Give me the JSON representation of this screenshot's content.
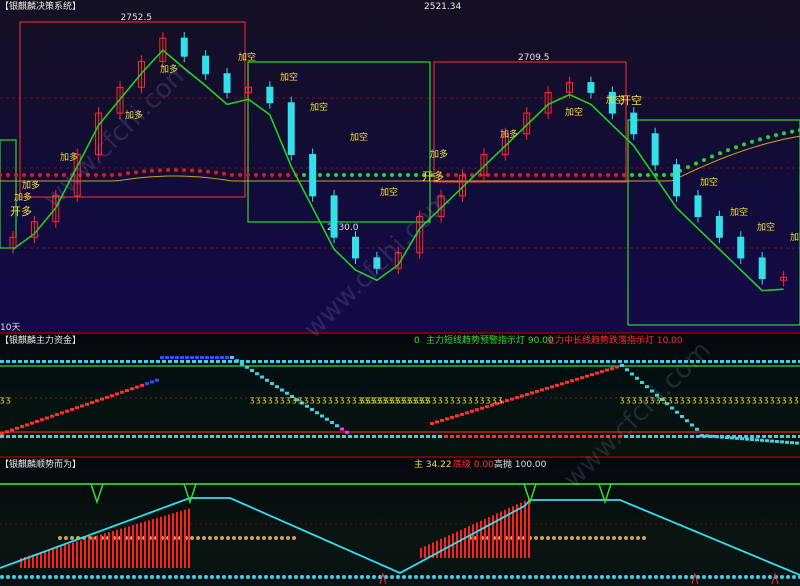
{
  "panel1": {
    "title": "【银麒麟决策系统】",
    "value": "2521.34",
    "period_label": "10天",
    "colors": {
      "up": "#ff2a2a",
      "down": "#33e0e8",
      "ma_red": "#ff2020",
      "ma_green": "#20d020",
      "yellow": "#d4a017",
      "text_signal": "#f0e040"
    }
  },
  "panel2": {
    "title": "【银麒麟主力资金】",
    "zero_label": "0",
    "legend": [
      {
        "text": "主力短线趋势预警指示灯 90.00",
        "color": "#33e033"
      },
      {
        "text": "主力中长线趋势跌落指示灯 10.00",
        "color": "#ff3030"
      }
    ]
  },
  "panel3": {
    "title": "【银麒麟顺势而为】",
    "legend": [
      {
        "text": "主 34.22",
        "color": "#f0e040"
      },
      {
        "text": "底级 0.00",
        "color": "#ff3030"
      },
      {
        "text": "高抛 100.00",
        "color": "#e0e0e0"
      }
    ]
  },
  "watermark": "www.cfchi.com",
  "chart_data": [
    {
      "type": "candlestick",
      "title": "【银麒麟决策系统】",
      "y_labels_printed": [
        "2752.5",
        "2530.0",
        "2709.5"
      ],
      "boxes": [
        {
          "color": "red",
          "label": "2752.5"
        },
        {
          "color": "green",
          "label": "2530.0"
        },
        {
          "color": "red",
          "label": "2709.5"
        },
        {
          "color": "green",
          "label": ""
        }
      ],
      "annotations": [
        "开多",
        "加多",
        "加多",
        "加多",
        "加多",
        "加多",
        "加空",
        "加空",
        "加空",
        "加空",
        "加空",
        "开多",
        "加多",
        "加多",
        "加空",
        "开空",
        "加空",
        "加空",
        "加空",
        "加空",
        "加空"
      ],
      "series": [
        {
          "name": "",
          "values": [
            2560,
            2575,
            2600,
            2640,
            2680,
            2705,
            2730,
            2752.5,
            2735,
            2718,
            2700,
            2705,
            2690,
            2640,
            2600,
            2560,
            2540,
            2530,
            2545,
            2580,
            2600,
            2620,
            2640,
            2660,
            2680,
            2700,
            2709.5,
            2700,
            2680,
            2660,
            2630,
            2600,
            2580,
            2560,
            2540,
            2520,
            2521.34
          ]
        }
      ]
    },
    {
      "type": "line",
      "title": "【银麒麟主力资金】",
      "series": [
        {
          "name": "主力短线趋势预警指示灯",
          "values": [
            90
          ]
        },
        {
          "name": "主力中长线趋势跌落指示灯",
          "values": [
            10
          ]
        }
      ]
    },
    {
      "type": "line",
      "title": "【银麒麟顺势而为】",
      "series": [
        {
          "name": "主",
          "values": [
            34.22
          ]
        },
        {
          "name": "底级",
          "values": [
            0.0
          ]
        },
        {
          "name": "高抛",
          "values": [
            100.0
          ]
        }
      ]
    }
  ]
}
